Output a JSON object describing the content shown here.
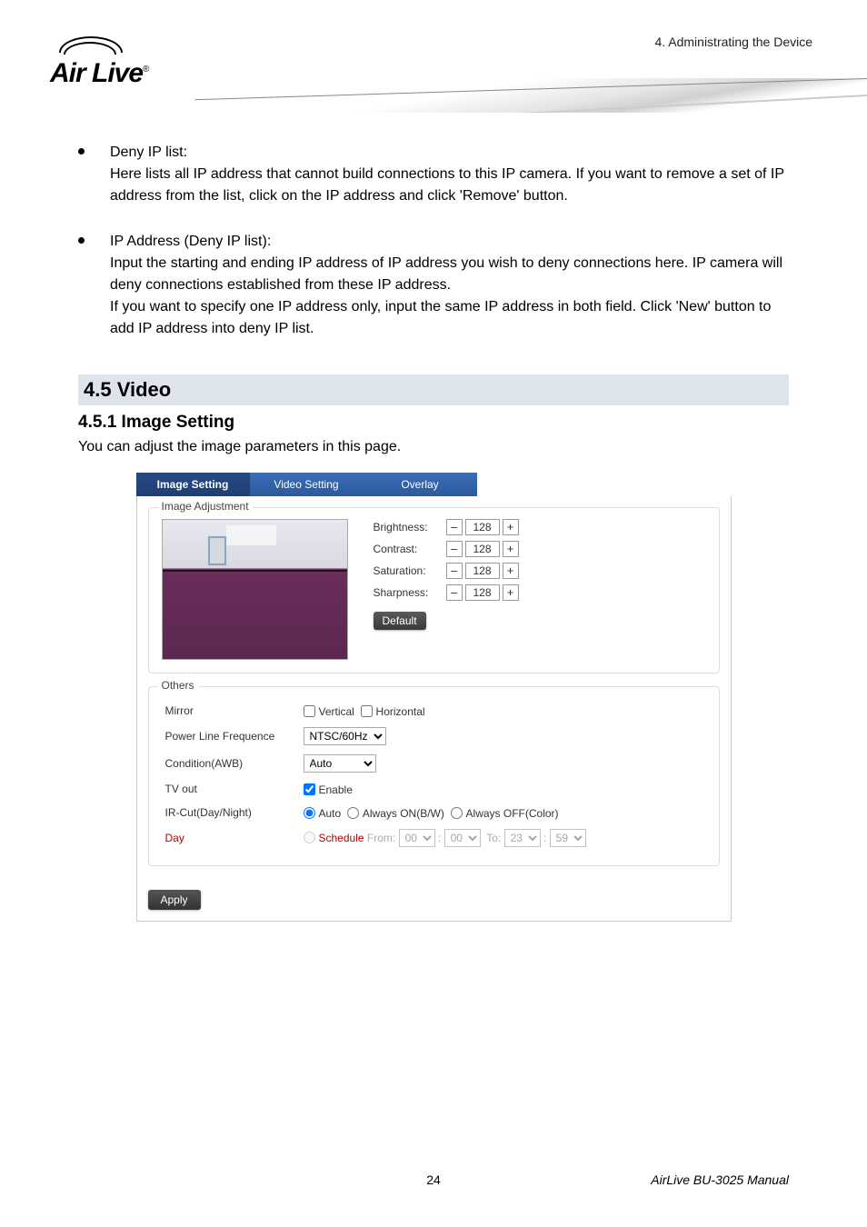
{
  "breadcrumb": "4.  Administrating  the  Device",
  "logo": {
    "text_a": "A",
    "text_rest": "ir Live",
    "reg": "®"
  },
  "bullets": [
    {
      "title": "Deny IP list:",
      "body": "Here lists all IP address that cannot build connections to this IP camera.    If you want to remove a set of IP address from the list, click on the IP address and click 'Remove' button."
    },
    {
      "title": "IP Address (Deny IP list):",
      "body": "Input the starting and ending IP address of IP address you wish to deny connections here.    IP camera will deny connections established from these IP address.\nIf you want to specify one IP address only, input the same IP address in both field. Click 'New' button to add IP address into deny IP list."
    }
  ],
  "section": {
    "heading": "4.5 Video",
    "sub": "4.5.1 Image Setting",
    "intro": "You can adjust the image parameters in this page."
  },
  "ui": {
    "tabs": [
      "Image Setting",
      "Video Setting",
      "Overlay"
    ],
    "fieldset1": "Image Adjustment",
    "sliders": [
      {
        "label": "Brightness:",
        "value": "128"
      },
      {
        "label": "Contrast:",
        "value": "128"
      },
      {
        "label": "Saturation:",
        "value": "128"
      },
      {
        "label": "Sharpness:",
        "value": "128"
      }
    ],
    "minus": "–",
    "plus": "+",
    "default_btn": "Default",
    "fieldset2": "Others",
    "others": {
      "mirror_label": "Mirror",
      "mirror_v": "Vertical",
      "mirror_h": "Horizontal",
      "plf_label": "Power Line Frequence",
      "plf_value": "NTSC/60Hz",
      "cond_label": "Condition(AWB)",
      "cond_value": "Auto",
      "tv_label": "TV out",
      "tv_enable": "Enable",
      "ir_label": "IR-Cut(Day/Night)",
      "ir_auto": "Auto",
      "ir_on": "Always ON(B/W)",
      "ir_off": "Always OFF(Color)",
      "day_label": "Day",
      "sched": "Schedule",
      "from": " From:",
      "from_h": "00",
      "from_m": "00",
      "to": "To:",
      "to_h": "23",
      "to_m": "59",
      "colon": ":"
    },
    "apply": "Apply"
  },
  "footer": {
    "page": "24",
    "right": "AirLive BU-3025 Manual"
  }
}
